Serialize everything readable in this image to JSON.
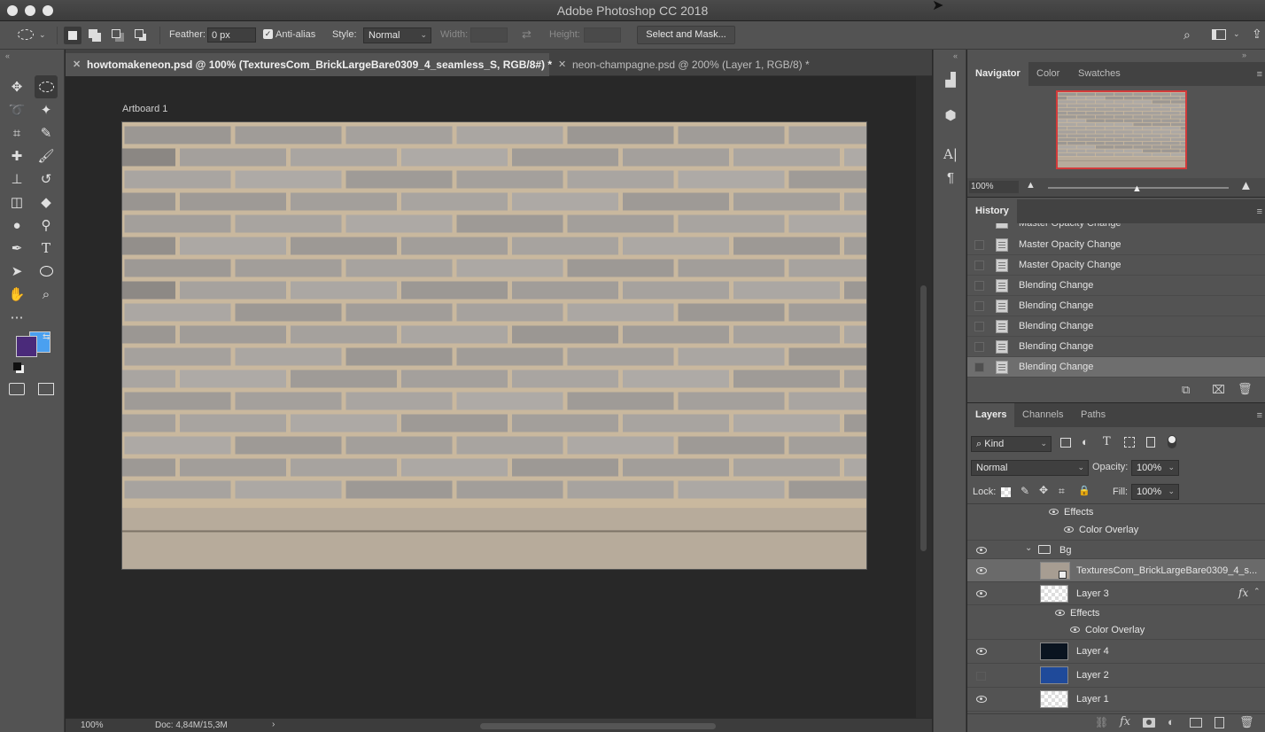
{
  "window": {
    "title": "Adobe Photoshop CC 2018"
  },
  "options_bar": {
    "feather_label": "Feather:",
    "feather_value": "0 px",
    "antialias_label": "Anti-alias",
    "antialias_checked": true,
    "style_label": "Style:",
    "style_value": "Normal",
    "width_label": "Width:",
    "height_label": "Height:",
    "select_mask_label": "Select and Mask..."
  },
  "tabs": [
    {
      "label": "howtomakeneon.psd @ 100% (TexturesCom_BrickLargeBare0309_4_seamless_S, RGB/8#) *",
      "active": true
    },
    {
      "label": "neon-champagne.psd @ 200% (Layer 1, RGB/8) *",
      "active": false
    }
  ],
  "canvas": {
    "artboard_label": "Artboard 1"
  },
  "status_bar": {
    "zoom": "100%",
    "doc_size": "Doc: 4,84M/15,3M"
  },
  "colors": {
    "foreground": "#4a2a7a",
    "background": "#4aa0f0",
    "accent_red": "#d23b3b"
  },
  "navigator": {
    "tabs": [
      "Navigator",
      "Color",
      "Swatches"
    ],
    "zoom": "100%"
  },
  "history": {
    "title": "History",
    "items": [
      "Master Opacity Change",
      "Master Opacity Change",
      "Blending Change",
      "Blending Change",
      "Blending Change",
      "Blending Change",
      "Blending Change"
    ],
    "selected_index": 6
  },
  "layers": {
    "tabs": [
      "Layers",
      "Channels",
      "Paths"
    ],
    "kind_label": "Kind",
    "blend_mode": "Normal",
    "opacity_label": "Opacity:",
    "opacity_value": "100%",
    "lock_label": "Lock:",
    "fill_label": "Fill:",
    "fill_value": "100%",
    "rows": {
      "effects_top": "Effects",
      "color_overlay_top": "Color Overlay",
      "group_bg": "Bg",
      "texture_layer": "TexturesCom_BrickLargeBare0309_4_s...",
      "layer3": "Layer 3",
      "fx": "fx",
      "effects_l3": "Effects",
      "color_overlay_l3": "Color Overlay",
      "layer4": "Layer 4",
      "layer2": "Layer 2",
      "layer1": "Layer 1"
    },
    "swatches": {
      "layer4": "#0a1420",
      "layer2": "#1f4a9a",
      "texture": "#a79d92"
    }
  }
}
